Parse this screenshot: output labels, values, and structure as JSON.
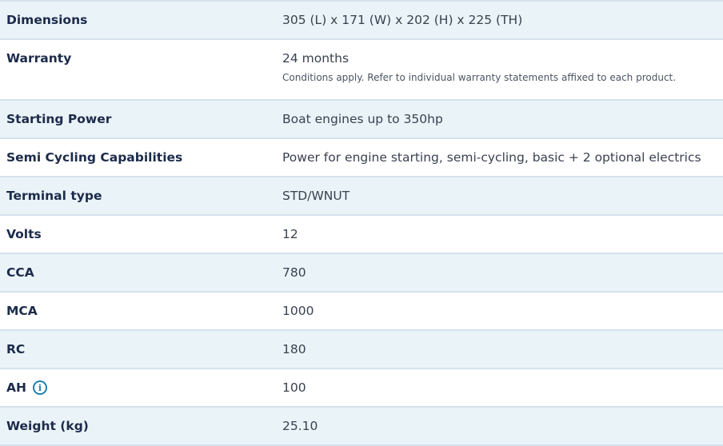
{
  "specs": [
    {
      "label": "Dimensions",
      "value": "305 (L) x 171 (W) x 202 (H) x 225 (TH)"
    },
    {
      "label": "Warranty",
      "value": "24 months",
      "note": "Conditions apply. Refer to individual warranty statements affixed to each product."
    },
    {
      "label": "Starting Power",
      "value": "Boat engines up to 350hp"
    },
    {
      "label": "Semi Cycling Capabilities",
      "value": "Power for engine starting, semi-cycling, basic + 2 optional electrics"
    },
    {
      "label": "Terminal type",
      "value": "STD/WNUT"
    },
    {
      "label": "Volts",
      "value": "12"
    },
    {
      "label": "CCA",
      "value": "780"
    },
    {
      "label": "MCA",
      "value": "1000"
    },
    {
      "label": "RC",
      "value": "180"
    },
    {
      "label": "AH",
      "value": "100",
      "icon": "info-icon",
      "icon_glyph": "i"
    },
    {
      "label": "Weight (kg)",
      "value": "25.10"
    }
  ],
  "colors": {
    "row_shaded": "#eaf3f8",
    "row_plain": "#ffffff",
    "border": "#d4e2ee",
    "label_text": "#1c2b4a",
    "value_text": "#3a4150",
    "icon": "#1f7fb2"
  }
}
